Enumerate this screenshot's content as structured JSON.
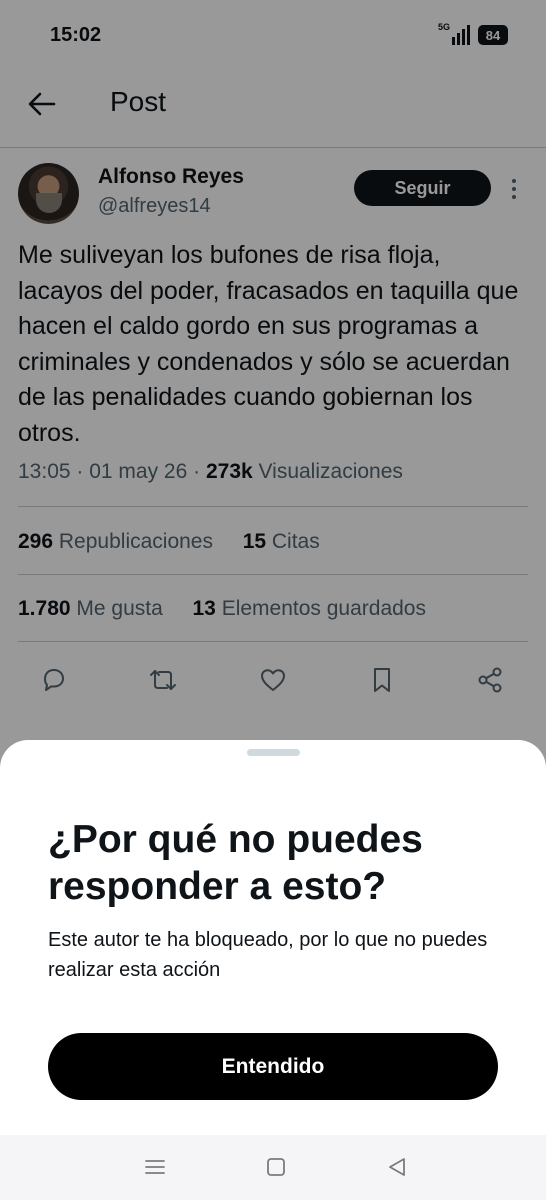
{
  "status_bar": {
    "time": "15:02",
    "network": "5G",
    "battery": "84"
  },
  "header": {
    "title": "Post",
    "back_icon": "arrow-left-icon"
  },
  "post": {
    "author_name": "Alfonso Reyes",
    "author_handle": "@alfreyes14",
    "follow_label": "Seguir",
    "text": "Me suliveyan los bufones de risa floja, lacayos del poder, fracasados en taquilla que hacen el caldo gordo en sus programas a criminales y condenados y sólo se acuerdan de las penalidades cuando gobiernan los otros.",
    "time": "13:05",
    "date": "01 may 26",
    "views_count": "273k",
    "views_label": "Visualizaciones"
  },
  "stats": {
    "reposts_count": "296",
    "reposts_label": "Republicaciones",
    "quotes_count": "15",
    "quotes_label": "Citas",
    "likes_count": "1.780",
    "likes_label": "Me gusta",
    "bookmarks_count": "13",
    "bookmarks_label": "Elementos guardados"
  },
  "actions": [
    "reply-icon",
    "repost-icon",
    "like-icon",
    "bookmark-icon",
    "share-icon"
  ],
  "sheet": {
    "title": "¿Por qué no puedes responder a esto?",
    "body": "Este autor te ha bloqueado, por lo que no puedes realizar esta acción",
    "button_label": "Entendido"
  },
  "nav": [
    "menu-icon",
    "home-square-icon",
    "back-triangle-icon"
  ],
  "colors": {
    "text_primary": "#0f1419",
    "text_secondary": "#536471",
    "divider": "#c8cdd2",
    "overlay": "rgba(0,0,0,0.4)",
    "button_dark": "#000000"
  }
}
